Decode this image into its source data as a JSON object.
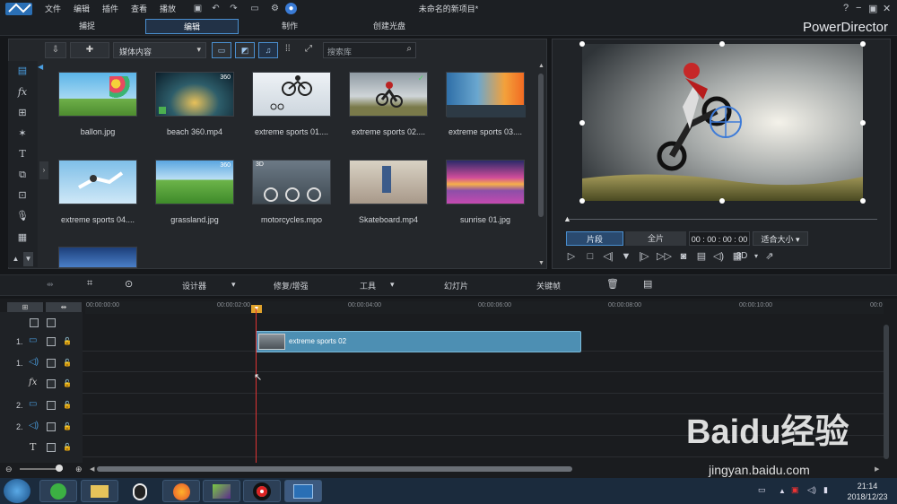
{
  "menu": {
    "items": [
      "文件",
      "编辑",
      "插件",
      "查看",
      "播放"
    ],
    "title": "未命名的新项目*"
  },
  "modes": {
    "tabs": [
      "捕捉",
      "编辑",
      "制作",
      "创建光盘"
    ],
    "active": "编辑",
    "brand": "PowerDirector"
  },
  "library": {
    "dropdown": "媒体内容",
    "search_placeholder": "搜索库",
    "items": [
      {
        "label": "ballon.jpg",
        "badge": ""
      },
      {
        "label": "beach 360.mp4",
        "badge": "360"
      },
      {
        "label": "extreme sports 01....",
        "badge": ""
      },
      {
        "label": "extreme sports 02....",
        "badge": "✓"
      },
      {
        "label": "extreme sports 03....",
        "badge": ""
      },
      {
        "label": "extreme sports 04....",
        "badge": ""
      },
      {
        "label": "grassland.jpg",
        "badge": "360"
      },
      {
        "label": "motorcycles.mpo",
        "badge": "3D"
      },
      {
        "label": "Skateboard.mp4",
        "badge": ""
      },
      {
        "label": "sunrise 01.jpg",
        "badge": ""
      }
    ]
  },
  "preview": {
    "clip_btn": "片段",
    "full_btn": "全片",
    "timecode": "00 : 00 : 00 : 00",
    "fit": "适合大小",
    "mode3d": "3D"
  },
  "edit_toolbar": {
    "designer": "设计器",
    "fix": "修复/增强",
    "tools": "工具",
    "slideshow": "幻灯片",
    "keyframe": "关键帧"
  },
  "timeline": {
    "ruler": [
      "00:00:00:00",
      "00:00:02:00",
      "00:00:04:00",
      "00:00:06:00",
      "00:00:08:00",
      "00:00:10:00",
      "00:0"
    ],
    "tracks": [
      {
        "num": "1.",
        "kind": "video-icon"
      },
      {
        "num": "1.",
        "kind": "audio-icon"
      },
      {
        "num": "",
        "kind": "fx-icon"
      },
      {
        "num": "2.",
        "kind": "video-icon"
      },
      {
        "num": "2.",
        "kind": "audio-icon"
      },
      {
        "num": "",
        "kind": "title-icon"
      }
    ],
    "clip_label": "extreme sports 02"
  },
  "taskbar": {
    "time": "21:14",
    "date": "2018/12/23"
  },
  "watermark": {
    "text": "Baidu经验",
    "url": "jingyan.baidu.com"
  },
  "colors": {
    "accent": "#4a8fd0",
    "clip": "#4d8fb3",
    "playhead": "#dd3333"
  }
}
